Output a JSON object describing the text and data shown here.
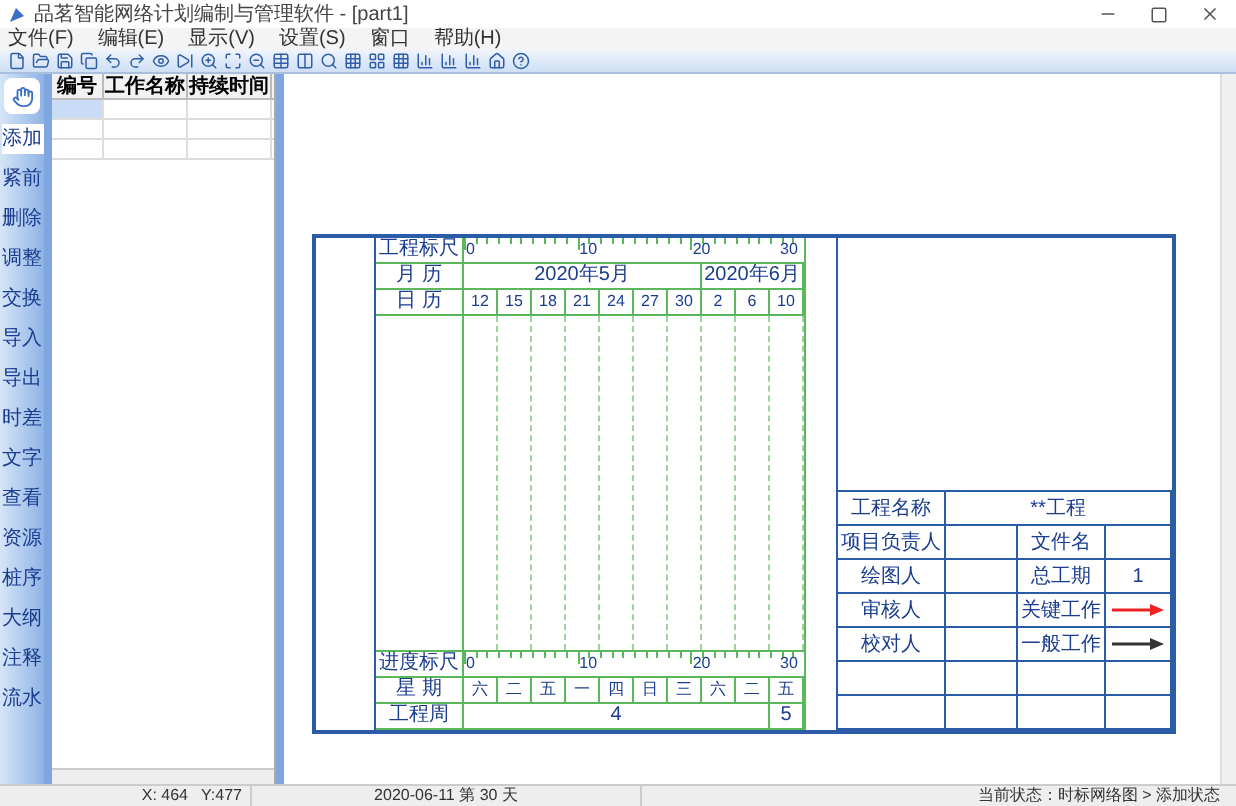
{
  "window": {
    "title": "品茗智能网络计划编制与管理软件 - [part1]"
  },
  "menu": [
    "文件(F)",
    "编辑(E)",
    "显示(V)",
    "设置(S)",
    "窗口",
    "帮助(H)"
  ],
  "side_tools": [
    {
      "label": "添加",
      "selected": true
    },
    {
      "label": "紧前",
      "selected": false
    },
    {
      "label": "删除",
      "selected": false
    },
    {
      "label": "调整",
      "selected": false
    },
    {
      "label": "交换",
      "selected": false
    },
    {
      "label": "导入",
      "selected": false
    },
    {
      "label": "导出",
      "selected": false
    },
    {
      "label": "时差",
      "selected": false
    },
    {
      "label": "文字",
      "selected": false
    },
    {
      "label": "查看",
      "selected": false
    },
    {
      "label": "资源",
      "selected": false
    },
    {
      "label": "桩序",
      "selected": false
    },
    {
      "label": "大纲",
      "selected": false
    },
    {
      "label": "注释",
      "selected": false
    },
    {
      "label": "流水",
      "selected": false
    }
  ],
  "task_table": {
    "columns": [
      "编号",
      "工作名称",
      "持续时间"
    ],
    "rows": [
      {
        "selected": true
      },
      {
        "selected": false
      },
      {
        "selected": false
      }
    ]
  },
  "gantt": {
    "ruler_label": "工程标尺",
    "ruler_ticks": [
      "0",
      "10",
      "20",
      "30"
    ],
    "month_label": "月 历",
    "day_label": "日 历",
    "months": [
      {
        "label": "2020年5月",
        "days": [
          "12",
          "15",
          "18",
          "21",
          "24",
          "27",
          "30"
        ]
      },
      {
        "label": "2020年6月",
        "days": [
          "2",
          "6",
          "10"
        ]
      }
    ],
    "progress_label": "进度标尺",
    "progress_ticks": [
      "0",
      "10",
      "20",
      "30"
    ],
    "weekday_label": "星 期",
    "week_label": "工程周",
    "weeks": [
      {
        "label": "4",
        "weekdays": [
          "六",
          "二",
          "五",
          "一",
          "四",
          "日",
          "三",
          "六",
          "二"
        ]
      },
      {
        "label": "5",
        "weekdays": [
          "五"
        ]
      }
    ]
  },
  "info_table": [
    {
      "kind": "wide",
      "label": "工程名称",
      "value": "**工程"
    },
    {
      "kind": "pair",
      "label": "项目负责人",
      "label2": "文件名"
    },
    {
      "kind": "pair",
      "label": "绘图人",
      "label2": "总工期",
      "value2": "1"
    },
    {
      "kind": "legend",
      "label": "审核人",
      "label2": "关键工作",
      "color": "#ee2222"
    },
    {
      "kind": "legend",
      "label": "校对人",
      "label2": "一般工作",
      "color": "#333333"
    },
    {
      "kind": "blank"
    },
    {
      "kind": "blank"
    }
  ],
  "status_bar": {
    "coords": "X: 464   Y:477",
    "date": "2020-06-11 第 30 天",
    "state": "当前状态：时标网络图 > 添加状态"
  }
}
